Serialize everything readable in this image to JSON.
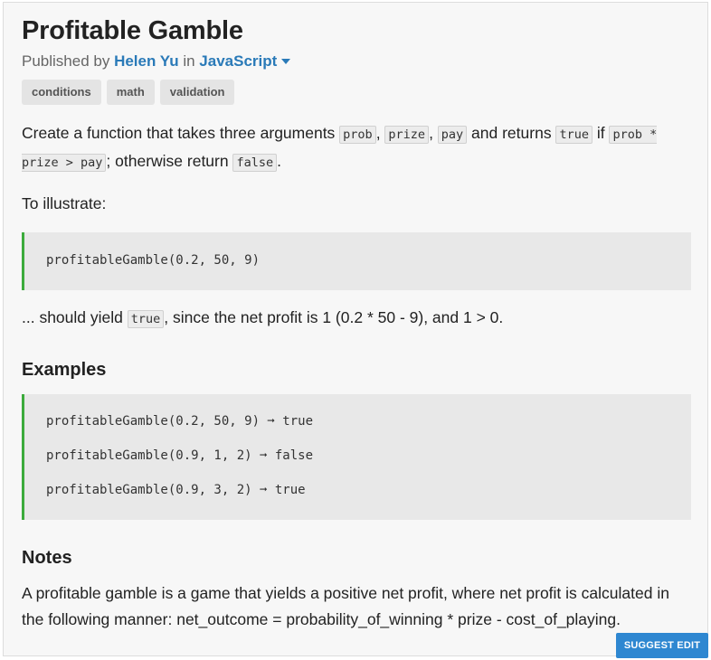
{
  "challenge": {
    "title": "Profitable Gamble",
    "published_by_label": "Published by",
    "author": "Helen Yu",
    "in_label": "in",
    "language": "JavaScript"
  },
  "tags": [
    "conditions",
    "math",
    "validation"
  ],
  "description": {
    "t1": "Create a function that takes three arguments ",
    "c_prob": "prob",
    "sep1": ", ",
    "c_prize": "prize",
    "sep2": ", ",
    "c_pay": "pay",
    "t2": " and returns ",
    "c_true": "true",
    "t3": " if ",
    "c_expr": "prob * prize > pay",
    "t4": "; otherwise return ",
    "c_false": "false",
    "t5": "."
  },
  "illustrate_label": "To illustrate:",
  "illustrate_code": "profitableGamble(0.2, 50, 9)",
  "yield": {
    "t1": "... should yield ",
    "c_true": "true",
    "t2": ", since the net profit is 1 (0.2 * 50 - 9), and 1 > 0."
  },
  "examples_heading": "Examples",
  "examples": [
    "profitableGamble(0.2, 50, 9) ➞ true",
    "profitableGamble(0.9, 1, 2) ➞ false",
    "profitableGamble(0.9, 3, 2) ➞ true"
  ],
  "notes_heading": "Notes",
  "notes_text": "A profitable gamble is a game that yields a positive net profit, where net profit is calculated in the following manner: net_outcome = probability_of_winning * prize - cost_of_playing.",
  "suggest_edit_label": "SUGGEST EDIT",
  "colors": {
    "link": "#2a7ab8",
    "code_border_accent": "#3cab3c",
    "button_bg": "#2e87d1"
  }
}
